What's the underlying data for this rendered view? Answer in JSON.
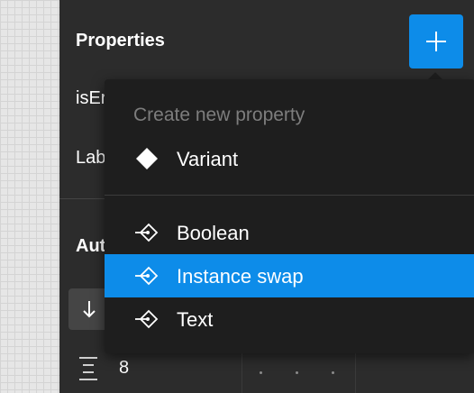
{
  "panel": {
    "title": "Properties",
    "properties": [
      "isEr",
      "Lab"
    ],
    "section_title": "Aut",
    "spacing_value": "8"
  },
  "dropdown": {
    "header": "Create new property",
    "items": [
      {
        "label": "Variant",
        "icon": "diamond-icon",
        "selected": false
      },
      {
        "label": "Boolean",
        "icon": "component-property-icon",
        "selected": false
      },
      {
        "label": "Instance swap",
        "icon": "component-property-icon",
        "selected": true
      },
      {
        "label": "Text",
        "icon": "component-property-icon",
        "selected": false
      }
    ]
  },
  "colors": {
    "accent": "#0d8ce9",
    "panel_bg": "#2c2c2c",
    "menu_bg": "#1e1e1e"
  }
}
